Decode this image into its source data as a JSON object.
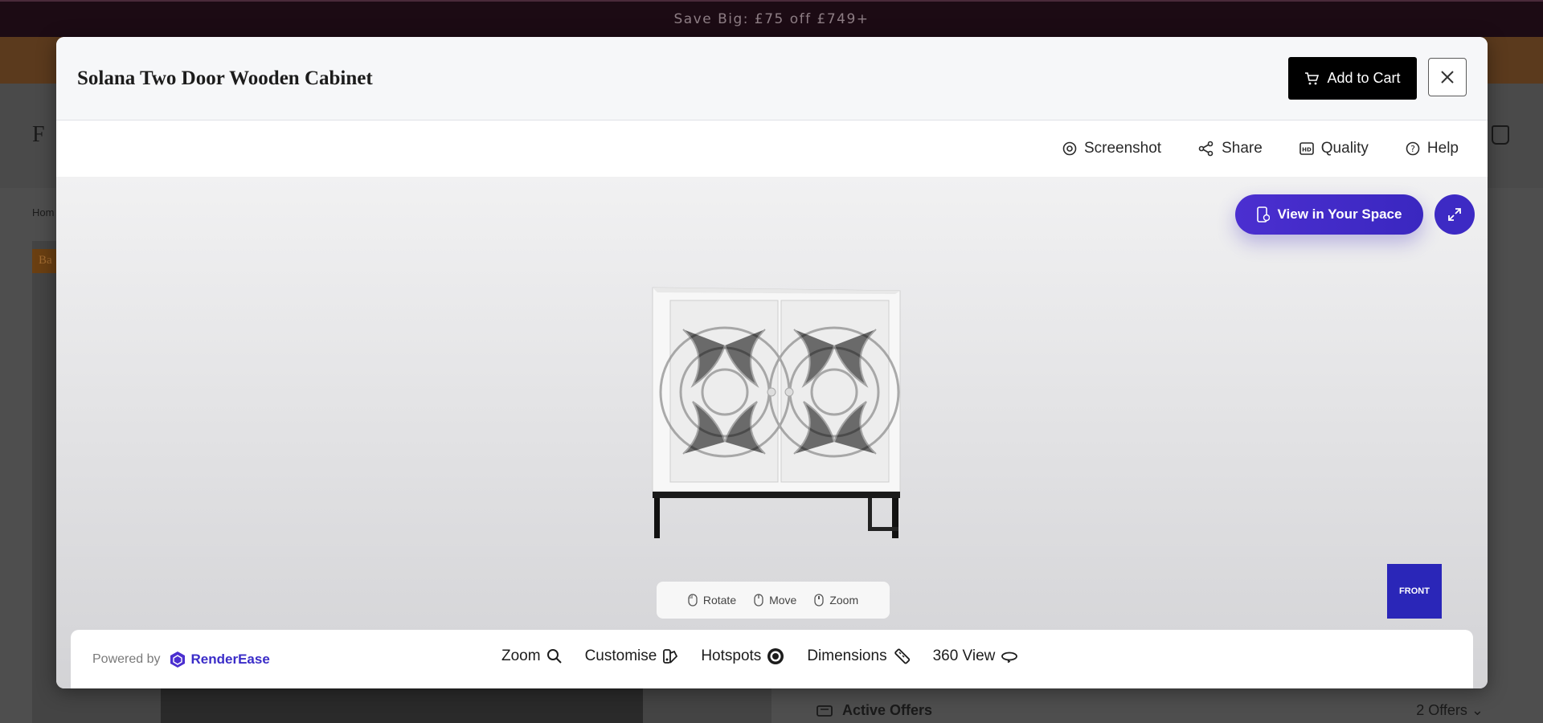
{
  "background": {
    "promo": "Save Big: £75 off £749+",
    "logo": "F A",
    "breadcrumb": "Hom",
    "badge": "Ba",
    "offers_label": "Active Offers",
    "offers_count": "2 Offers"
  },
  "modal": {
    "title": "Solana Two Door Wooden Cabinet",
    "add_to_cart": "Add to Cart",
    "toolbar": {
      "screenshot": "Screenshot",
      "share": "Share",
      "quality": "Quality",
      "help": "Help"
    },
    "viewer": {
      "view_in_space": "View in Your Space",
      "hints": {
        "rotate": "Rotate",
        "move": "Move",
        "zoom": "Zoom"
      },
      "orientation_cube": "FRONT"
    },
    "footer": {
      "powered_by": "Powered by",
      "brand": "RenderEase",
      "features": {
        "zoom": "Zoom",
        "customise": "Customise",
        "hotspots": "Hotspots",
        "dimensions": "Dimensions",
        "view360": "360 View"
      }
    }
  },
  "colors": {
    "accent": "#3d2ac4",
    "cart_button": "#000000",
    "promo_bg": "#1c0b14"
  }
}
